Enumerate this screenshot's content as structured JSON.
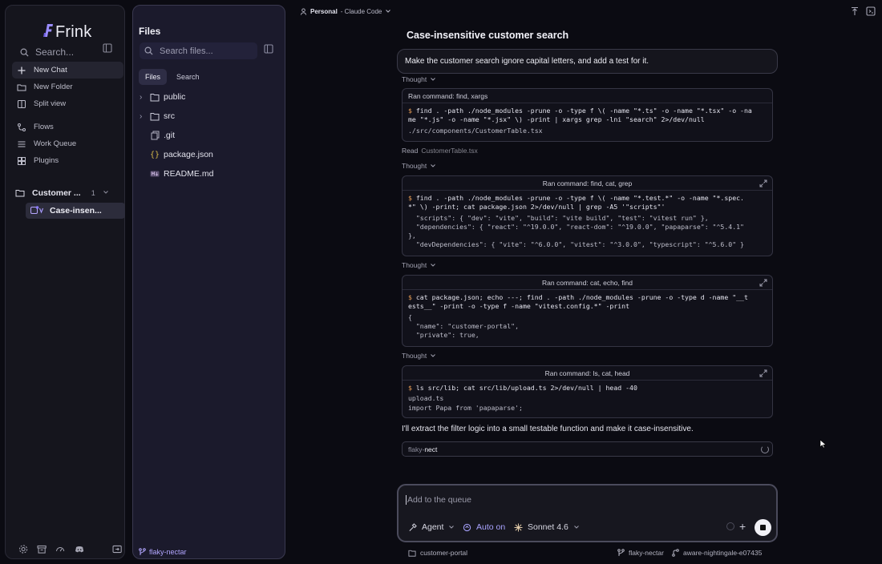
{
  "app": {
    "name": "Frink"
  },
  "sidebar": {
    "search_placeholder": "Search...",
    "nav": [
      {
        "label": "New Chat",
        "icon": "plus-icon"
      },
      {
        "label": "New Folder",
        "icon": "folder-plus-icon"
      },
      {
        "label": "Split view",
        "icon": "split-view-icon"
      },
      {
        "label": "Flows",
        "icon": "flows-icon"
      },
      {
        "label": "Work Queue",
        "icon": "list-icon"
      },
      {
        "label": "Plugins",
        "icon": "plugins-icon"
      }
    ],
    "project": {
      "name": "Customer ...",
      "count": "1"
    },
    "chat_item": "Case-insen...",
    "bottom_icons": [
      "settings-icon",
      "archive-icon",
      "gauge-icon",
      "discord-icon",
      "folder-switch-icon"
    ]
  },
  "files": {
    "title": "Files",
    "search_placeholder": "Search files...",
    "tabs": [
      "Files",
      "Search"
    ],
    "tree": [
      {
        "name": "public",
        "type": "folder"
      },
      {
        "name": "src",
        "type": "folder"
      },
      {
        "name": ".git",
        "type": "file"
      },
      {
        "name": "package.json",
        "type": "json"
      },
      {
        "name": "README.md",
        "type": "markdown"
      }
    ],
    "branch": "flaky-nectar"
  },
  "topbar": {
    "workspace": "Personal",
    "agent": "- Claude Code"
  },
  "chat": {
    "title": "Case-insensitive customer search",
    "user_message": "Make the customer search ignore capital letters, and add a test for it.",
    "thought_label": "Thought",
    "read": {
      "label": "Read",
      "file": "CustomerTable.tsx"
    },
    "commands": [
      {
        "header": "Ran command: find, xargs",
        "command": "find . -path ./node_modules -prune -o -type f \\( -name \"*.ts\" -o -name \"*.tsx\" -o -na\nme \"*.js\" -o -name \"*.jsx\" \\) -print | xargs grep -lni \"search\" 2>/dev/null",
        "output": "./src/components/CustomerTable.tsx"
      },
      {
        "header": "Ran command: find, cat, grep",
        "command": "find . -path ./node_modules -prune -o -type f \\( -name \"*.test.*\" -o -name \"*.spec.\n*\" \\) -print; cat package.json 2>/dev/null | grep -A5 '\"scripts\"'",
        "output": "  \"scripts\": { \"dev\": \"vite\", \"build\": \"vite build\", \"test\": \"vitest run\" },\n  \"dependencies\": { \"react\": \"^19.0.0\", \"react-dom\": \"^19.0.0\", \"papaparse\": \"^5.4.1\"\n},\n  \"devDependencies\": { \"vite\": \"^6.0.0\", \"vitest\": \"^3.0.0\", \"typescript\": \"^5.6.0\" }"
      },
      {
        "header": "Ran command: cat, echo, find",
        "command": "cat package.json; echo ---; find . -path ./node_modules -prune -o -type d -name \"__t\nests__\" -print -o -type f -name \"vitest.config.*\" -print",
        "output": "{\n  \"name\": \"customer-portal\",\n  \"private\": true,"
      },
      {
        "header": "Ran command: ls, cat, head",
        "command": "ls src/lib; cat src/lib/upload.ts 2>/dev/null | head -40",
        "output": "upload.ts\nimport Papa from 'papaparse';"
      }
    ],
    "assistant_text": "I'll extract the filter logic into a small testable function and make it case-insensitive.",
    "pending": {
      "dim": "flaky-",
      "bright": "nect"
    }
  },
  "composer": {
    "placeholder": "Add to the queue",
    "agent_label": "Agent",
    "auto_label": "Auto on",
    "model_label": "Sonnet 4.6"
  },
  "footer": {
    "folder": "customer-portal",
    "branch": "flaky-nectar",
    "worktree": "aware-nightingale-e07435"
  },
  "colors": {
    "accent": "#9a8cff",
    "prompt": "#e39a54",
    "background": "#0b0b12"
  }
}
